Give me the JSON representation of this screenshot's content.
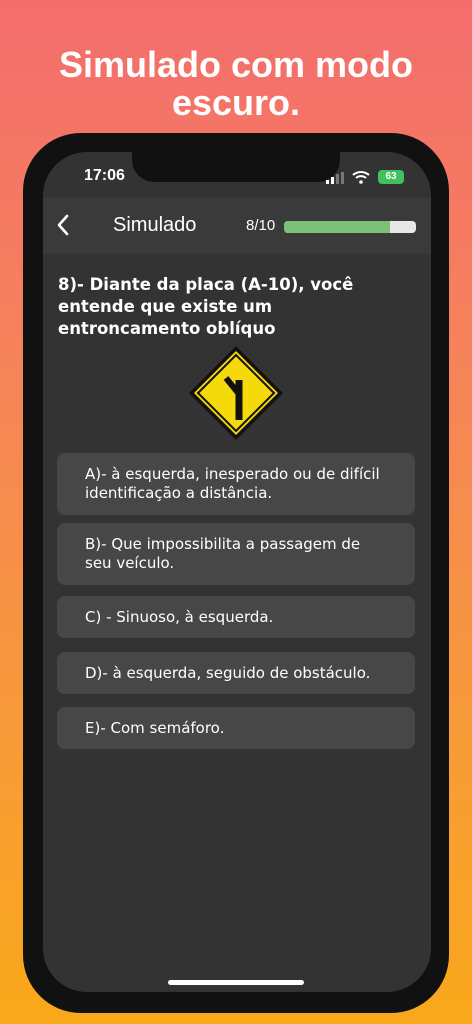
{
  "promo": {
    "headline": "Simulado com modo escuro."
  },
  "status_bar": {
    "time": "17:06",
    "battery": "63"
  },
  "navbar": {
    "title": "Simulado",
    "progress_label": "8/10",
    "progress_value": 0.8
  },
  "question": {
    "text": "8)- Diante da placa (A-10), você entende que existe um entroncamento oblíquo",
    "sign_icon": "y-junction-warning-sign"
  },
  "options": [
    {
      "label": "A)- à esquerda, inesperado ou de difícil identificação a distância."
    },
    {
      "label": "B)- Que impossibilita a passagem de seu veículo."
    },
    {
      "label": "C) - Sinuoso, à esquerda."
    },
    {
      "label": "D)- à esquerda, seguido de obstáculo."
    },
    {
      "label": "E)- Com semáforo."
    }
  ],
  "colors": {
    "accent": "#7ac27a",
    "sign_yellow": "#f5d90a",
    "screen_bg": "#333333",
    "option_bg": "#474747"
  }
}
